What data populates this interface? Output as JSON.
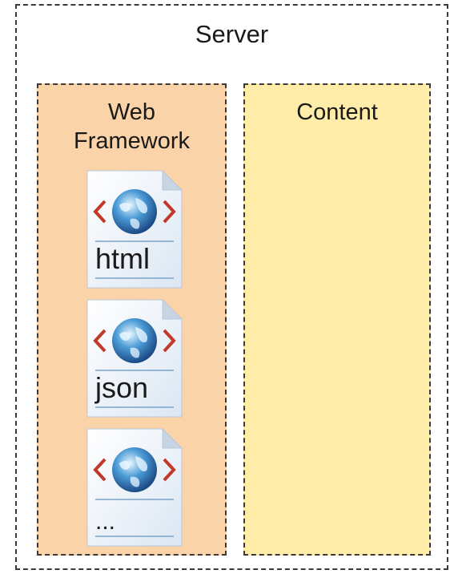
{
  "server": {
    "title": "Server"
  },
  "web_framework": {
    "title_line1": "Web",
    "title_line2": "Framework",
    "files": [
      {
        "label": "html",
        "icon": "web-document-icon"
      },
      {
        "label": "json",
        "icon": "web-document-icon"
      },
      {
        "label": "...",
        "icon": "web-document-icon"
      }
    ]
  },
  "content": {
    "title": "Content"
  },
  "colors": {
    "framework_fill": "#fbd3a8",
    "content_fill": "#ffeca8",
    "border": "#3a3a3a"
  }
}
